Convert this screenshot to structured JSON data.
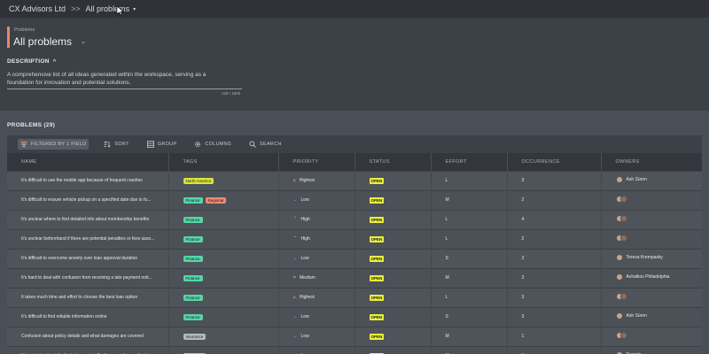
{
  "topbar": {
    "org": "CX Advisors Ltd",
    "separator": ">>",
    "current": "All problems",
    "caret": "▾"
  },
  "header": {
    "small_label": "Problems",
    "title": "All problems",
    "title_chevron": "⌄",
    "description_heading": "DESCRIPTION",
    "description_toggle": "^",
    "description": "A comprehensive list of all ideas generated within the workspace, serving as a foundation for innovation and potential solutions.",
    "char_count": "129 / 1500"
  },
  "section": {
    "title": "PROBLEMS (29)"
  },
  "toolbar": {
    "filter": "FILTERED BY 1 FIELD",
    "sort": "SORT",
    "group": "GROUP",
    "columns": "COLUMNS",
    "search": "SEARCH"
  },
  "columns": [
    "NAME",
    "TAGS",
    "PRIORITY",
    "STATUS",
    "EFFORT",
    "OCCURRENCE",
    "OWNERS"
  ],
  "rows": [
    {
      "name": "It's difficult to use the mobile app because of frequent crashes",
      "tags": [
        "North America"
      ],
      "priority": "Highest",
      "status": "OPEN",
      "effort": "L",
      "occurrence": "3",
      "owner": "Ash Süren"
    },
    {
      "name": "It's difficult to ensure vehicle pickup on a specified date due to fu...",
      "tags": [
        "Finance",
        "Regional"
      ],
      "priority": "Low",
      "status": "OPEN",
      "effort": "M",
      "occurrence": "2",
      "owner": ""
    },
    {
      "name": "It's unclear where to find detailed info about membership benefits",
      "tags": [
        "Finance"
      ],
      "priority": "High",
      "status": "OPEN",
      "effort": "L",
      "occurrence": "4",
      "owner": ""
    },
    {
      "name": "It's unclear beforehand if there are potential penalties or fees asso...",
      "tags": [
        "Finance"
      ],
      "priority": "High",
      "status": "OPEN",
      "effort": "L",
      "occurrence": "2",
      "owner": ""
    },
    {
      "name": "It's difficult to overcome anxiety over loan approval duration",
      "tags": [
        "Finance"
      ],
      "priority": "Low",
      "status": "OPEN",
      "effort": "S",
      "occurrence": "2",
      "owner": "Tereza Krempasky"
    },
    {
      "name": "It's hard to deal with confusion from receiving a late payment noti...",
      "tags": [
        "Finance"
      ],
      "priority": "Medium",
      "status": "OPEN",
      "effort": "M",
      "occurrence": "3",
      "owner": "Achalkos Philadelphia"
    },
    {
      "name": "It takes much time and effort to choose the best loan option",
      "tags": [
        "Finance"
      ],
      "priority": "Highest",
      "status": "OPEN",
      "effort": "L",
      "occurrence": "3",
      "owner": ""
    },
    {
      "name": "It's difficult to find reliable information online",
      "tags": [
        "Finance"
      ],
      "priority": "Low",
      "status": "OPEN",
      "effort": "S",
      "occurrence": "3",
      "owner": "Ash Süren"
    },
    {
      "name": "Confusion about policy details and what damages are covered",
      "tags": [
        "Insurance"
      ],
      "priority": "Low",
      "status": "OPEN",
      "effort": "M",
      "occurrence": "1",
      "owner": ""
    },
    {
      "name": "Uncertainty about the fastest or most effective reporting method",
      "tags": [
        "Insurance"
      ],
      "priority": "Low",
      "status": "OPEN",
      "effort": "M",
      "occurrence": "1",
      "owner": "Daniela"
    }
  ],
  "colors": {
    "accent": "#e8856d",
    "status_open": "#e8f03a",
    "tag_finance": "#55d6a7",
    "tag_north_america": "#d8e53a",
    "tag_regional": "#f08a73",
    "tag_insurance": "#b6b9bf"
  },
  "icons": {
    "filter": "filter-icon",
    "sort": "sort-icon",
    "group": "group-icon",
    "columns": "gear-icon",
    "search": "search-icon",
    "priority_highest": "double-chevron-up-icon",
    "priority_high": "chevron-up-icon",
    "priority_low": "chevron-down-icon",
    "priority_medium": "equals-icon"
  }
}
